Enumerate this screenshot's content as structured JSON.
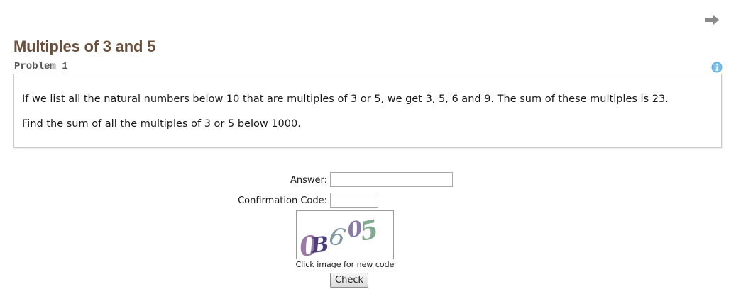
{
  "navigation": {
    "next_icon": "right-arrow-icon"
  },
  "problem": {
    "title": "Multiples of 3 and 5",
    "subtitle": "Problem 1",
    "info_icon": "info-icon",
    "paragraphs": [
      "If we list all the natural numbers below 10 that are multiples of 3 or 5, we get 3, 5, 6 and 9. The sum of these multiples is 23.",
      "Find the sum of all the multiples of 3 or 5 below 1000."
    ]
  },
  "form": {
    "answer_label": "Answer:",
    "answer_value": "",
    "code_label": "Confirmation Code:",
    "code_value": "",
    "captcha_text": "0B605",
    "captcha_caption": "Click image for new code",
    "check_label": "Check"
  },
  "colors": {
    "title": "#6b4f3a",
    "subtitle": "#555555",
    "box_border": "#c8c8c8",
    "info_icon": "#5aa6d8",
    "arrow": "#8a8a8a"
  }
}
